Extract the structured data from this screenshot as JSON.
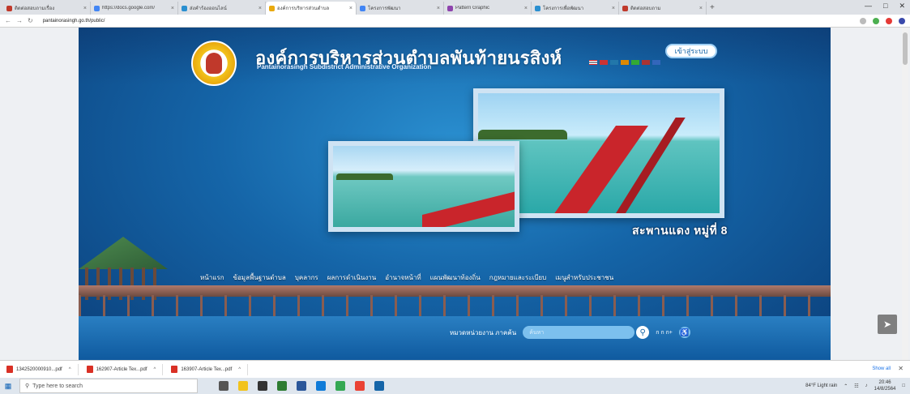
{
  "browser": {
    "tabs": [
      {
        "label": "ติดต่อสอบถามเรื่อง",
        "color": "#c0392b"
      },
      {
        "label": "https://docs.google.com/",
        "color": "#4285f4"
      },
      {
        "label": "ส่งคำร้องออนไลน์",
        "color": "#2a8fd0"
      },
      {
        "label": "องค์การบริหารส่วนตำบล",
        "color": "#e9a90e",
        "active": true
      },
      {
        "label": "โครงการพัฒนา",
        "color": "#4285f4"
      },
      {
        "label": "Pattern Graphic",
        "color": "#8e44ad"
      },
      {
        "label": "โครงการเพื่อพัฒนา",
        "color": "#2a8fd0"
      },
      {
        "label": "ติดต่อสอบถาม",
        "color": "#c0392b"
      }
    ],
    "new_tab": "+",
    "url": "pantainorasingh.go.th/public/"
  },
  "site": {
    "org_name_th": "องค์การบริหารส่วนตำบลพันท้ายนรสิงห์",
    "org_name_en": "Pantainorasingh Subdistrict Administrative Organization",
    "login_label": "เข้าสู่ระบบ",
    "photo_caption": "สะพานแดง หมู่ที่ 8",
    "nav": [
      "หน้าแรก",
      "ข้อมูลพื้นฐานตำบล",
      "บุคลากร",
      "ผลการดำเนินงาน",
      "อำนาจหน้าที่",
      "แผนพัฒนาท้องถิ่น",
      "กฎหมายและระเบียบ",
      "เมนูสำหรับประชาชน"
    ],
    "search_label": "หมวดหน่วยงาน ภาคค้น",
    "search_placeholder": "ค้นหา",
    "font_size_label": "ก ก ก+"
  },
  "downloads": [
    {
      "name": "1342520000910...pdf"
    },
    {
      "name": "162907-Article Tex...pdf"
    },
    {
      "name": "163907-Article Tex...pdf"
    }
  ],
  "downloads_show_all": "Show all",
  "taskbar": {
    "search_placeholder": "Type here to search",
    "weather": "84°F Light rain",
    "time": "20:46",
    "date": "14/8/2564"
  },
  "colors": {
    "site_blue": "#1565a8",
    "bridge_red": "#c9252b"
  }
}
